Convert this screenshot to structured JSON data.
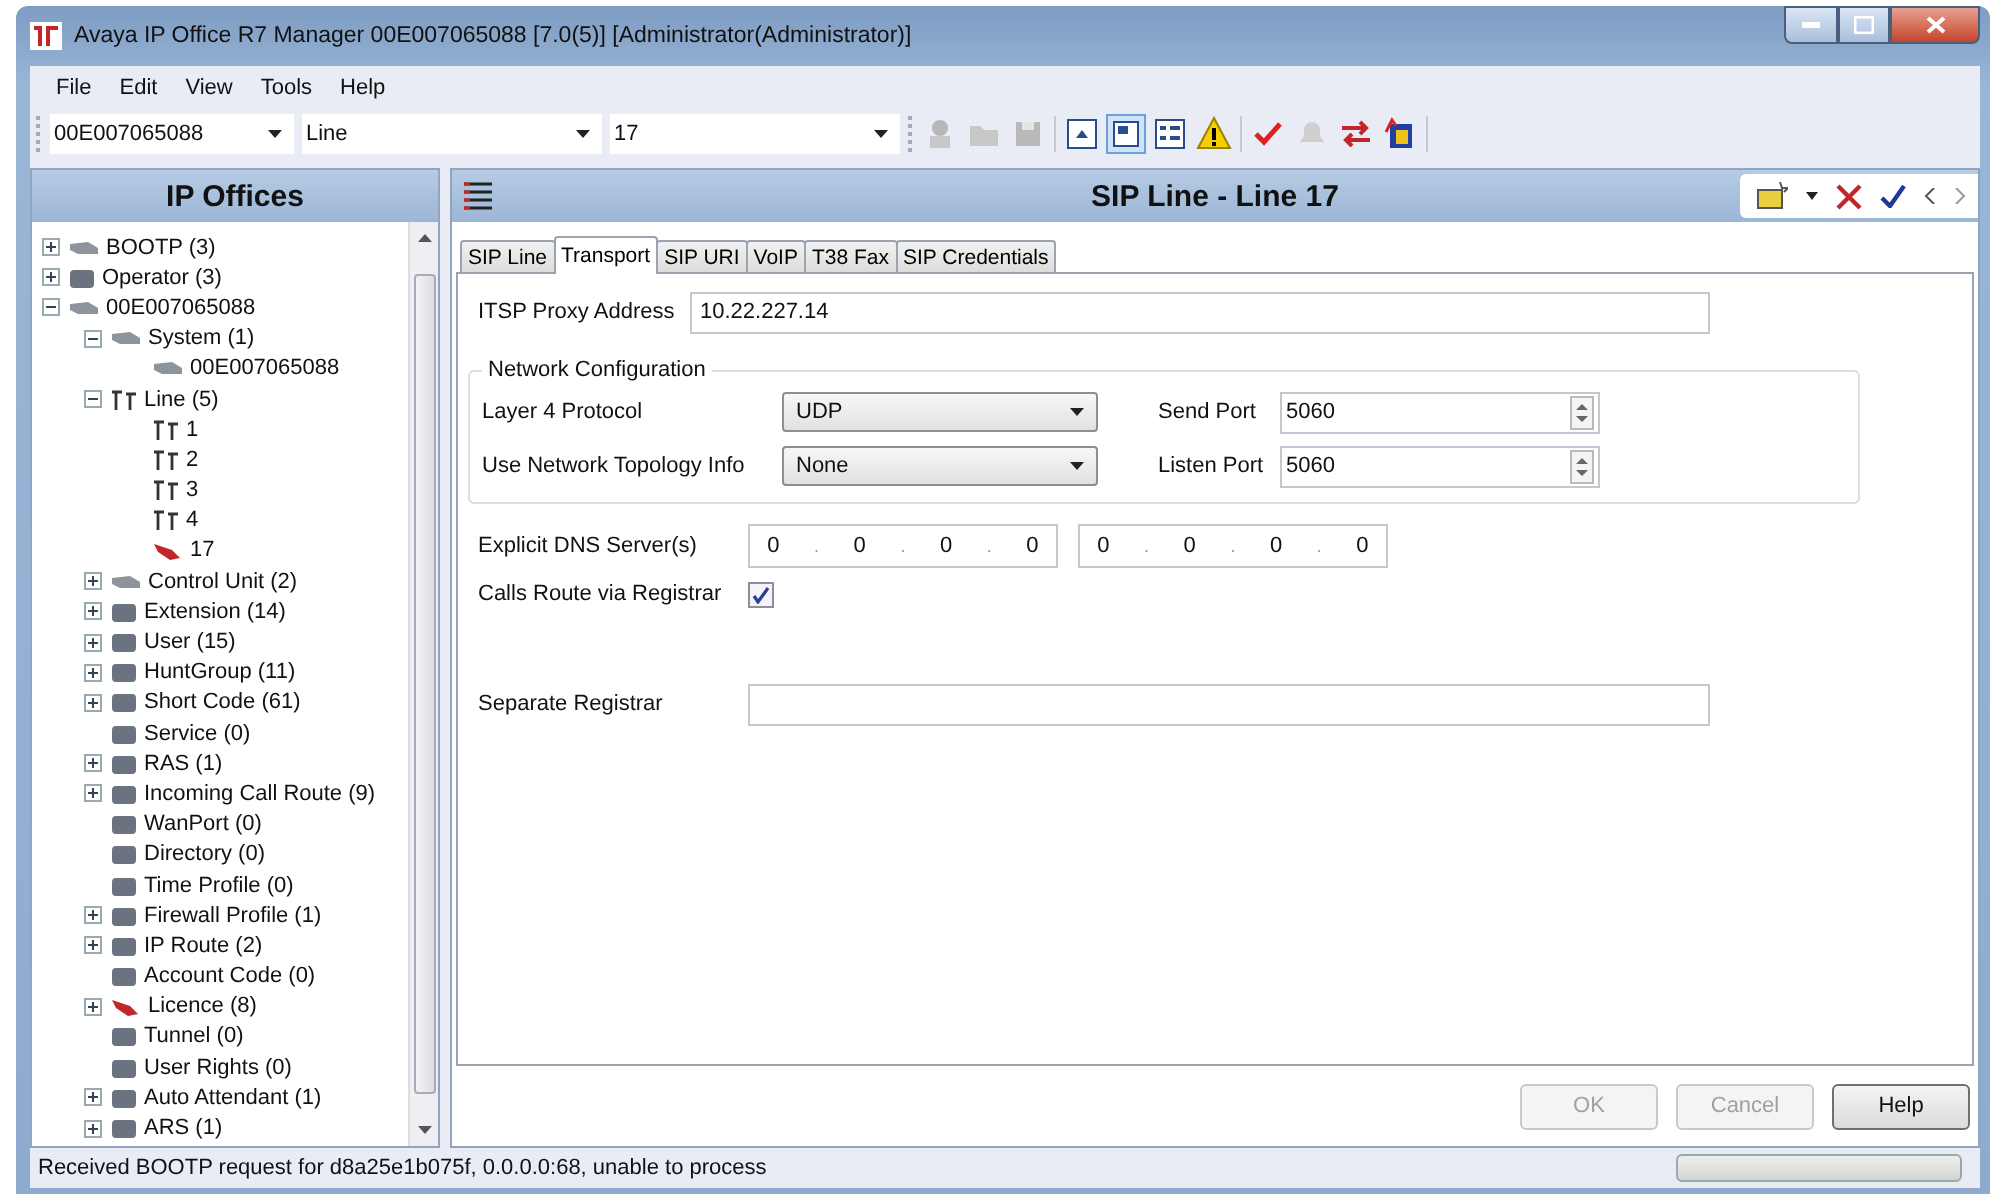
{
  "window": {
    "title": "Avaya IP Office R7 Manager 00E007065088 [7.0(5)] [Administrator(Administrator)]"
  },
  "menu": [
    "File",
    "Edit",
    "View",
    "Tools",
    "Help"
  ],
  "toolbar": {
    "selectors": [
      "00E007065088",
      "Line",
      "17"
    ]
  },
  "navigator": {
    "title": "IP Offices",
    "tree": [
      {
        "label": "BOOTP (3)",
        "kind": "device",
        "expanded": false
      },
      {
        "label": "Operator (3)",
        "kind": "entry",
        "expanded": false
      },
      {
        "label": "00E007065088",
        "kind": "device",
        "expanded": true,
        "children": [
          {
            "label": "System (1)",
            "kind": "device",
            "expanded": true,
            "children": [
              {
                "label": "00E007065088",
                "kind": "device"
              }
            ]
          },
          {
            "label": "Line (5)",
            "kind": "line",
            "expanded": true,
            "children": [
              {
                "label": "1",
                "kind": "line"
              },
              {
                "label": "2",
                "kind": "line"
              },
              {
                "label": "3",
                "kind": "line"
              },
              {
                "label": "4",
                "kind": "line"
              },
              {
                "label": "17",
                "kind": "sip"
              }
            ]
          },
          {
            "label": "Control Unit (2)",
            "kind": "device",
            "expanded": false
          },
          {
            "label": "Extension (14)",
            "kind": "entry",
            "expanded": false
          },
          {
            "label": "User (15)",
            "kind": "entry",
            "expanded": false
          },
          {
            "label": "HuntGroup (11)",
            "kind": "entry",
            "expanded": false
          },
          {
            "label": "Short Code (61)",
            "kind": "entry",
            "expanded": false
          },
          {
            "label": "Service (0)",
            "kind": "entry"
          },
          {
            "label": "RAS (1)",
            "kind": "entry",
            "expanded": false
          },
          {
            "label": "Incoming Call Route (9)",
            "kind": "entry",
            "expanded": false
          },
          {
            "label": "WanPort (0)",
            "kind": "entry"
          },
          {
            "label": "Directory (0)",
            "kind": "entry"
          },
          {
            "label": "Time Profile (0)",
            "kind": "entry"
          },
          {
            "label": "Firewall Profile (1)",
            "kind": "entry",
            "expanded": false
          },
          {
            "label": "IP Route (2)",
            "kind": "entry",
            "expanded": false
          },
          {
            "label": "Account Code (0)",
            "kind": "entry"
          },
          {
            "label": "Licence (8)",
            "kind": "sip",
            "expanded": false
          },
          {
            "label": "Tunnel (0)",
            "kind": "entry"
          },
          {
            "label": "User Rights (0)",
            "kind": "entry"
          },
          {
            "label": "Auto Attendant (1)",
            "kind": "entry",
            "expanded": false
          },
          {
            "label": "ARS (1)",
            "kind": "entry",
            "expanded": false
          }
        ]
      }
    ]
  },
  "editor": {
    "title": "SIP Line - Line 17",
    "tabs": [
      {
        "label": "SIP Line",
        "selected": false
      },
      {
        "label": "Transport",
        "selected": true
      },
      {
        "label": "SIP URI",
        "selected": false
      },
      {
        "label": "VoIP",
        "selected": false
      },
      {
        "label": "T38 Fax",
        "selected": false
      },
      {
        "label": "SIP Credentials",
        "selected": false
      }
    ],
    "itsp_proxy_address": {
      "label": "ITSP Proxy Address",
      "value": "10.22.227.14"
    },
    "network_configuration": {
      "title": "Network Configuration",
      "layer4_protocol": {
        "label": "Layer 4 Protocol",
        "value": "UDP"
      },
      "send_port": {
        "label": "Send Port",
        "value": "5060"
      },
      "use_network_topology_info": {
        "label": "Use Network Topology Info",
        "value": "None"
      },
      "listen_port": {
        "label": "Listen Port",
        "value": "5060"
      }
    },
    "explicit_dns_servers": {
      "label": "Explicit DNS Server(s)",
      "octet_separator": ".",
      "servers": [
        [
          "0",
          "0",
          "0",
          "0"
        ],
        [
          "0",
          "0",
          "0",
          "0"
        ]
      ]
    },
    "calls_route_via_registrar": {
      "label": "Calls Route via Registrar",
      "checked": true
    },
    "separate_registrar": {
      "label": "Separate Registrar"
    },
    "buttons": [
      {
        "label": "OK",
        "disabled": true
      },
      {
        "label": "Cancel",
        "disabled": true
      },
      {
        "label": "Help",
        "disabled": false
      }
    ]
  },
  "status_bar": {
    "message": "Received BOOTP request for d8a25e1b075f, 0.0.0.0:68, unable to process",
    "progress": {
      "level": 0
    }
  }
}
